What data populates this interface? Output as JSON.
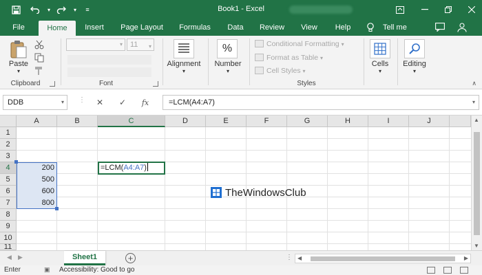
{
  "titlebar": {
    "document_title": "Book1  -  Excel",
    "quick_access": [
      "save-icon",
      "undo-icon",
      "redo-icon",
      "customize-icon"
    ],
    "window_controls": [
      "ribbon-display-icon",
      "minimize-icon",
      "restore-icon",
      "close-icon"
    ]
  },
  "ribbon_tabs": [
    "File",
    "Home",
    "Insert",
    "Page Layout",
    "Formulas",
    "Data",
    "Review",
    "View",
    "Help"
  ],
  "active_tab": "Home",
  "tell_me": "Tell me",
  "ribbon": {
    "clipboard": {
      "paste_label": "Paste",
      "group_label": "Clipboard"
    },
    "font": {
      "font_name": "",
      "font_size": "11",
      "group_label": "Font"
    },
    "alignment": {
      "label": "Alignment"
    },
    "number": {
      "label": "Number",
      "icon_text": "%"
    },
    "styles": {
      "conditional_formatting": "Conditional Formatting",
      "format_as_table": "Format as Table",
      "cell_styles": "Cell Styles",
      "group_label": "Styles"
    },
    "cells": {
      "label": "Cells"
    },
    "editing": {
      "label": "Editing"
    }
  },
  "formula_bar": {
    "name_box": "DDB",
    "cancel_symbol": "✕",
    "enter_symbol": "✓",
    "fx_symbol": "fx",
    "formula": "=LCM(A4:A7)"
  },
  "columns": [
    "A",
    "B",
    "C",
    "D",
    "E",
    "F",
    "G",
    "H",
    "I",
    "J"
  ],
  "selected_column": "C",
  "rows": [
    "1",
    "2",
    "3",
    "4",
    "5",
    "6",
    "7",
    "8",
    "9",
    "10",
    "11"
  ],
  "cells": {
    "A4": "200",
    "A5": "500",
    "A6": "600",
    "A7": "800",
    "C4_prefix": "=LCM(",
    "C4_ref": "A4:A7",
    "C4_suffix": ")"
  },
  "watermark": "TheWindowsClub",
  "sheets": {
    "tabs": [
      "Sheet1"
    ],
    "active": "Sheet1"
  },
  "status_bar": {
    "mode": "Enter",
    "accessibility": "Accessibility: Good to go"
  },
  "colors": {
    "accent": "#217346",
    "reference_blue": "#4472c4",
    "range_fill": "#dde6f3"
  }
}
